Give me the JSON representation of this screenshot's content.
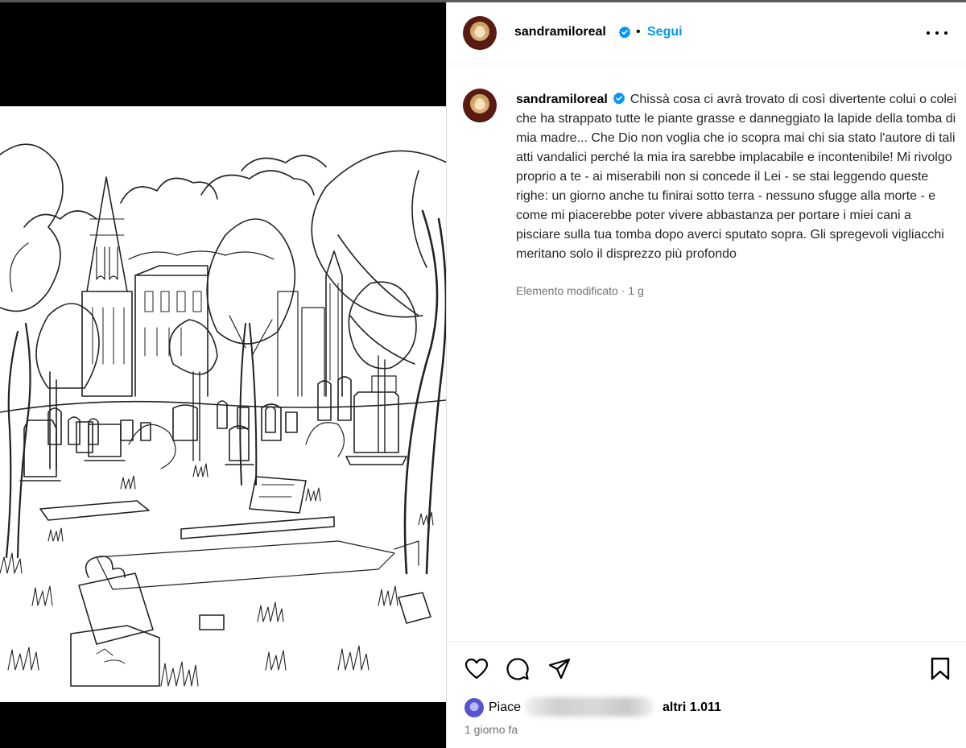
{
  "post": {
    "username": "sandramiloreal",
    "follow_label": "Segui",
    "separator": "•",
    "caption": "Chissà cosa ci avrà trovato di così divertente colui o colei che ha strappato tutte le piante grasse e danneggiato la lapide della tomba di mia madre... Che Dio non voglia che io scopra mai chi sia stato l'autore di tali atti vandalici perché la mia ira sarebbe implacabile e incontenibile! Mi rivolgo proprio a te - ai miserabili non si concede il Lei - se stai leggendo queste righe: un giorno anche tu finirai sotto terra - nessuno sfugge alla morte - e come mi piacerebbe poter vivere abbastanza per portare i miei cani a pisciare sulla tua tomba dopo averci sputato sopra. Gli spregevoli vigliacchi meritano solo il disprezzo più profondo",
    "edited_meta": "Elemento modificato · 1 g",
    "likes_prefix": "Piace",
    "likes_suffix": "altri 1.011",
    "posted_time": "1 giorno fa"
  },
  "icons": {
    "verified": "verified-badge-icon",
    "more": "more-options-icon",
    "like": "heart-icon",
    "comment": "comment-bubble-icon",
    "share": "paper-plane-icon",
    "save": "bookmark-icon"
  },
  "colors": {
    "follow": "#0095f6",
    "verified": "#0095f6",
    "secondary_text": "#737373"
  }
}
